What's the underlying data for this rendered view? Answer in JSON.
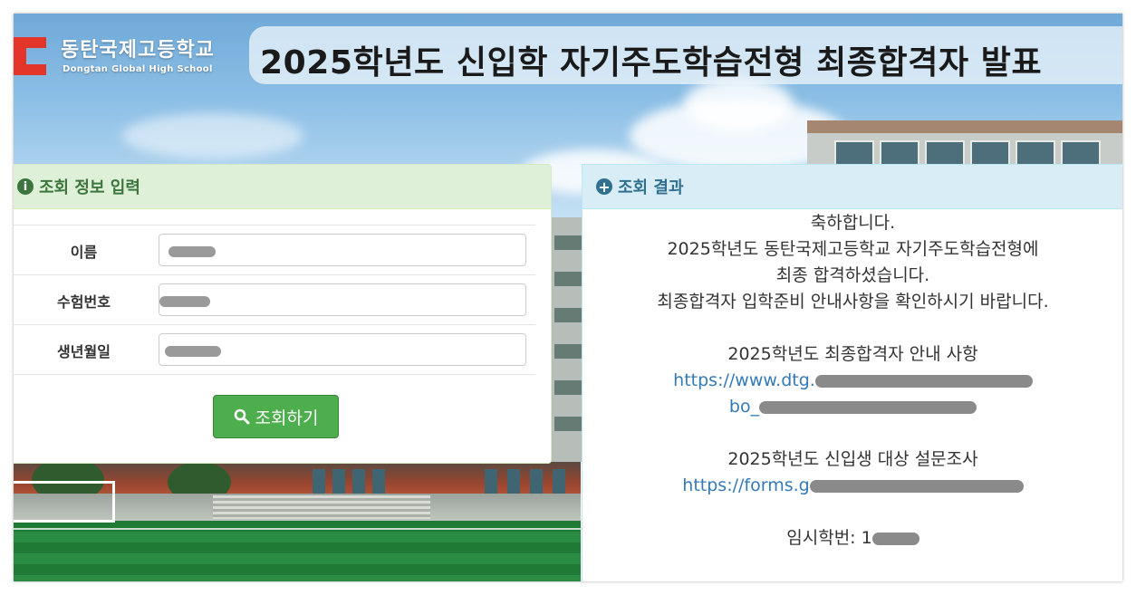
{
  "header": {
    "school_name_ko": "동탄국제고등학교",
    "school_name_en": "Dongtan Global High School",
    "title": "2025학년도 신입학 자기주도학습전형 최종합격자 발표"
  },
  "form_panel": {
    "title": "조회 정보 입력",
    "icon": "info-icon",
    "fields": [
      {
        "label": "이름",
        "value": ""
      },
      {
        "label": "수험번호",
        "value": ""
      },
      {
        "label": "생년월일",
        "value": ""
      }
    ],
    "submit_label": "조회하기",
    "submit_icon": "search-icon"
  },
  "result_panel": {
    "title": "조회 결과",
    "icon": "plus-circle-icon",
    "message_lines": [
      "축하합니다.",
      "2025학년도 동탄국제고등학교 자기주도학습전형에",
      "최종 합격하셨습니다.",
      "최종합격자 입학준비 안내사항을 확인하시기 바랍니다."
    ],
    "notice_title": "2025학년도 최종합격자 안내 사항",
    "notice_link_line1": "https://www.dtg.",
    "notice_link_line2": "bo_",
    "survey_title": "2025학년도 신입생 대상 설문조사",
    "survey_link": "https://forms.g",
    "temp_id_label": "임시학번: 1"
  },
  "colors": {
    "form_header_bg": "#dff0d8",
    "form_header_text": "#3c763d",
    "result_header_bg": "#d9edf7",
    "result_header_text": "#31708f",
    "button": "#4cae4c",
    "link": "#337ab7",
    "logo_red": "#e4352a"
  }
}
